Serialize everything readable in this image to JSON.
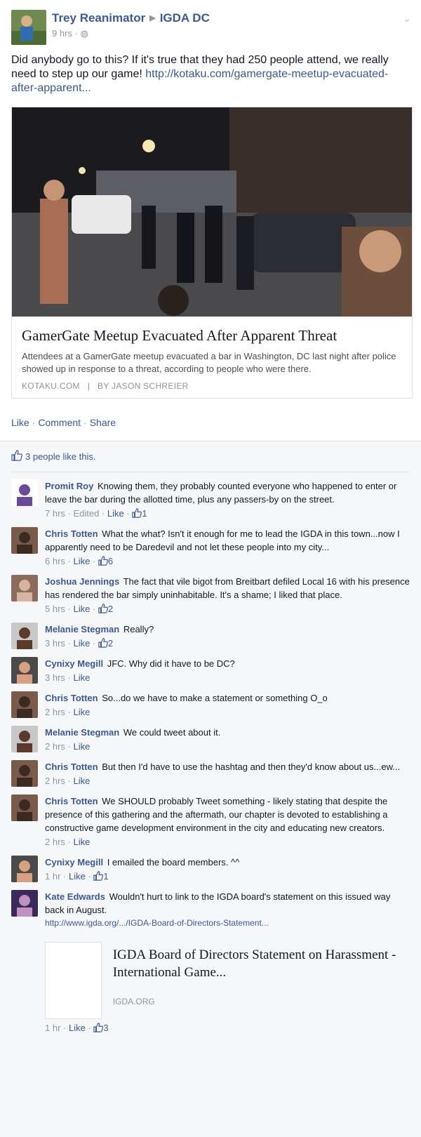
{
  "post": {
    "author": "Trey Reanimator",
    "group": "IGDA DC",
    "time": "9 hrs",
    "text": "Did anybody go to this? If it's true that they had 250 people attend, we really need to step up our game! ",
    "link_text": "http://kotaku.com/gamergate-meetup-evacuated-after-apparent...",
    "card": {
      "title": "GamerGate Meetup Evacuated After Apparent Threat",
      "description": "Attendees at a GamerGate meetup evacuated a bar in Washington, DC last night after police showed up in response to a threat, according to people who were there.",
      "source": "KOTAKU.COM",
      "byline": "BY JASON SCHREIER"
    },
    "actions": {
      "like": "Like",
      "comment": "Comment",
      "share": "Share"
    },
    "likes_summary": "3 people like this."
  },
  "comments": [
    {
      "name": "Promit Roy",
      "text": "Knowing them, they probably counted everyone who happened to enter or leave the bar during the allotted time, plus any passers-by on the street.",
      "time": "7 hrs",
      "edited": "Edited",
      "like": "Like",
      "count": "1"
    },
    {
      "name": "Chris Totten",
      "text": "What the what? Isn't it enough for me to lead the IGDA in this town...now I apparently need to be Daredevil and not let these people into my city...",
      "time": "6 hrs",
      "like": "Like",
      "count": "6"
    },
    {
      "name": "Joshua Jennings",
      "text": "The fact that vile bigot from Breitbart defiled Local 16 with his presence has rendered the bar simply uninhabitable. It's a shame; I liked that place.",
      "time": "5 hrs",
      "like": "Like",
      "count": "2"
    },
    {
      "name": "Melanie Stegman",
      "text": "Really?",
      "time": "3 hrs",
      "like": "Like",
      "count": "2"
    },
    {
      "name": "Cynixy Megill",
      "text": "JFC. Why did it have to be DC?",
      "time": "3 hrs",
      "like": "Like"
    },
    {
      "name": "Chris Totten",
      "text": "So...do we have to make a statement or something O_o",
      "time": "2 hrs",
      "like": "Like"
    },
    {
      "name": "Melanie Stegman",
      "text": "We could tweet about it.",
      "time": "2 hrs",
      "like": "Like"
    },
    {
      "name": "Chris Totten",
      "text": "But then I'd have to use the hashtag and then they'd know about us...ew...",
      "time": "2 hrs",
      "like": "Like"
    },
    {
      "name": "Chris Totten",
      "text": "We SHOULD probably Tweet something - likely stating that despite the presence of this gathering and the aftermath, our chapter is devoted to establishing a constructive game development environment in the city and educating new creators.",
      "time": "2 hrs",
      "like": "Like"
    },
    {
      "name": "Cynixy Megill",
      "text": "I emailed the board members. ^^",
      "time": "1 hr",
      "like": "Like",
      "count": "1"
    },
    {
      "name": "Kate Edwards",
      "text": "Wouldn't hurt to link to the IGDA board's statement on this issued way back in August.",
      "link": "http://www.igda.org/.../IGDA-Board-of-Directors-Statement...",
      "card_title": "IGDA Board of Directors Statement on Harassment - International Game...",
      "card_source": "IGDA.ORG",
      "time": "1 hr",
      "like": "Like",
      "count": "3"
    }
  ],
  "colors": {
    "link": "#3b5998",
    "meta": "#90949c",
    "text": "#141823",
    "background": "#f6f7f9"
  }
}
